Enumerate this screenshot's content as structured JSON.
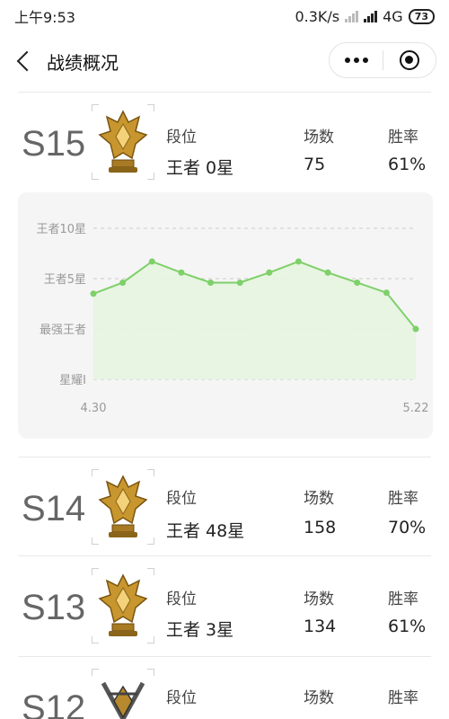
{
  "status_bar": {
    "time": "上午9:53",
    "speed": "0.3K/s",
    "network": "4G",
    "battery": "73"
  },
  "nav": {
    "title": "战绩概况"
  },
  "labels": {
    "rank": "段位",
    "games": "场数",
    "winrate": "胜率"
  },
  "seasons": [
    {
      "season": "S15",
      "rank": "王者 0星",
      "games": "75",
      "winrate": "61%",
      "icon": "king-rank-badge-icon"
    },
    {
      "season": "S14",
      "rank": "王者 48星",
      "games": "158",
      "winrate": "70%",
      "icon": "king-rank-badge-icon"
    },
    {
      "season": "S13",
      "rank": "王者 3星",
      "games": "134",
      "winrate": "61%",
      "icon": "king-rank-badge-icon"
    },
    {
      "season": "S12",
      "rank": "",
      "games": "",
      "winrate": "",
      "icon": "starlight-rank-badge-icon"
    }
  ],
  "colors": {
    "line": "#7ed069",
    "fill": "#e6f5e0",
    "card": "#f5f5f5",
    "gridline": "#cccccc"
  },
  "chart_data": {
    "type": "area",
    "y_tick_labels": [
      "王者10星",
      "王者5星",
      "最强王者",
      "星耀I"
    ],
    "x_start_label": "4.30",
    "x_end_label": "5.22",
    "values": [
      3.5,
      4.6,
      6.7,
      5.6,
      4.6,
      4.6,
      5.6,
      6.7,
      5.6,
      4.6,
      3.6,
      0
    ],
    "ylim": [
      -10,
      15
    ],
    "y_ticks": [
      10,
      5,
      0,
      -5
    ]
  }
}
